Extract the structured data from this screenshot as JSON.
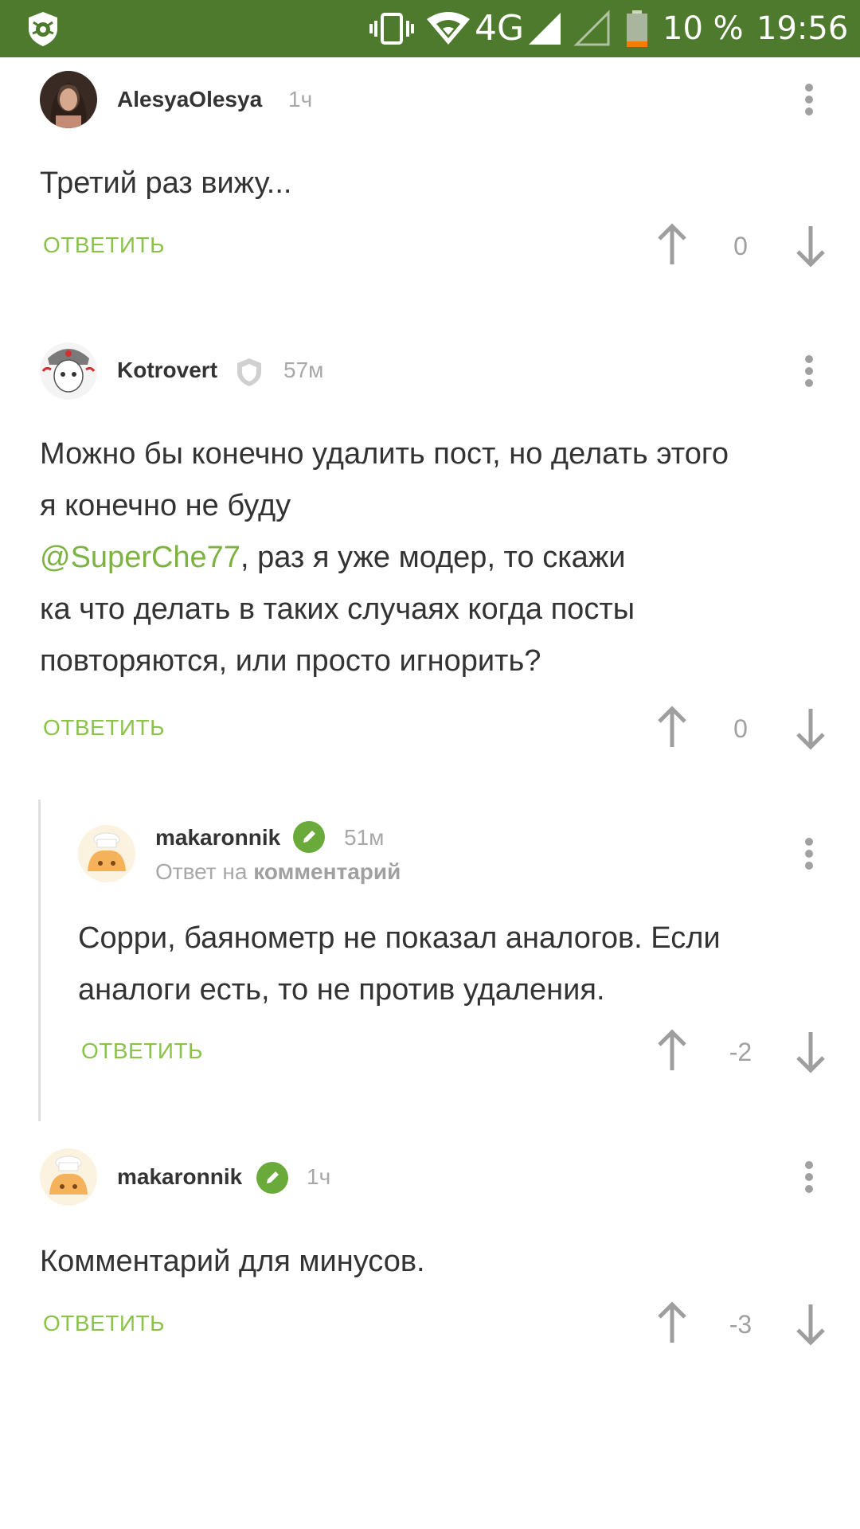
{
  "status_bar": {
    "network": "4G",
    "battery": "10 %",
    "time": "19:56",
    "bg_color": "#4e7a2e"
  },
  "comments": [
    {
      "username": "AlesyaOlesya",
      "time": "1ч",
      "text": "Третий раз вижу...",
      "reply_label": "ОТВЕТИТЬ",
      "votes": "0"
    },
    {
      "username": "Kotrovert",
      "time": "57м",
      "badge": "shield-icon",
      "text_lines": [
        "Можно бы конечно удалить пост, но делать этого",
        "я конечно не буду"
      ],
      "mention": "@SuperChe77",
      "mention_rest": ", раз я уже модер, то скажи",
      "text_lines_2": [
        "ка что делать в таких случаях когда посты",
        "повторяются, или просто игнорить?"
      ],
      "reply_label": "ОТВЕТИТЬ",
      "votes": "0"
    },
    {
      "username": "makaronnik",
      "time": "51м",
      "badge": "pencil-icon",
      "reply_to_prefix": "Ответ на",
      "reply_to_target": "комментарий",
      "text_lines": [
        "Сорри, баянометр не показал аналогов. Если",
        "аналоги есть, то не против удаления."
      ],
      "reply_label": "ОТВЕТИТЬ",
      "votes": "-2"
    },
    {
      "username": "makaronnik",
      "time": "1ч",
      "badge": "pencil-icon",
      "text": "Комментарий для минусов.",
      "reply_label": "ОТВЕТИТЬ",
      "votes": "-3"
    }
  ],
  "colors": {
    "accent_green": "#8bc34a",
    "mention_green": "#7cb342",
    "badge_green": "#6aaa3a"
  }
}
